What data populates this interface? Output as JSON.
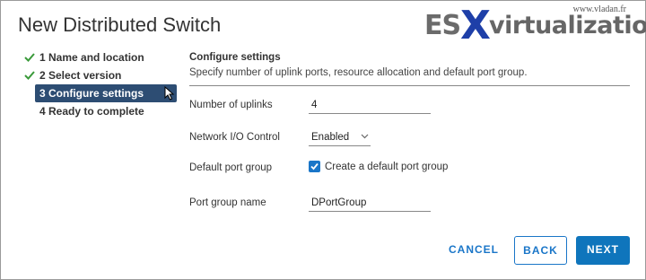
{
  "dialog": {
    "title": "New Distributed Switch"
  },
  "watermark": {
    "site": "www.vladan.fr",
    "es": "ES",
    "x": "X",
    "rest": "virtualization"
  },
  "steps": [
    {
      "label": "1 Name and location",
      "state": "complete"
    },
    {
      "label": "2 Select version",
      "state": "complete"
    },
    {
      "label": "3 Configure settings",
      "state": "active"
    },
    {
      "label": "4 Ready to complete",
      "state": "pending"
    }
  ],
  "section": {
    "title": "Configure settings",
    "description": "Specify number of uplink ports, resource allocation and default port group."
  },
  "form": {
    "uplinks_label": "Number of uplinks",
    "uplinks_value": "4",
    "nioc_label": "Network I/O Control",
    "nioc_value": "Enabled",
    "default_pg_label": "Default port group",
    "default_pg_checked": true,
    "default_pg_checkbox_label": "Create a default port group",
    "pg_name_label": "Port group name",
    "pg_name_value": "DPortGroup"
  },
  "buttons": {
    "cancel": "CANCEL",
    "back": "BACK",
    "next": "NEXT"
  },
  "colors": {
    "accent": "#1a76c8",
    "active_step": "#2d4d73",
    "check": "#3a9a3a",
    "primary_button": "#0f75bc"
  }
}
